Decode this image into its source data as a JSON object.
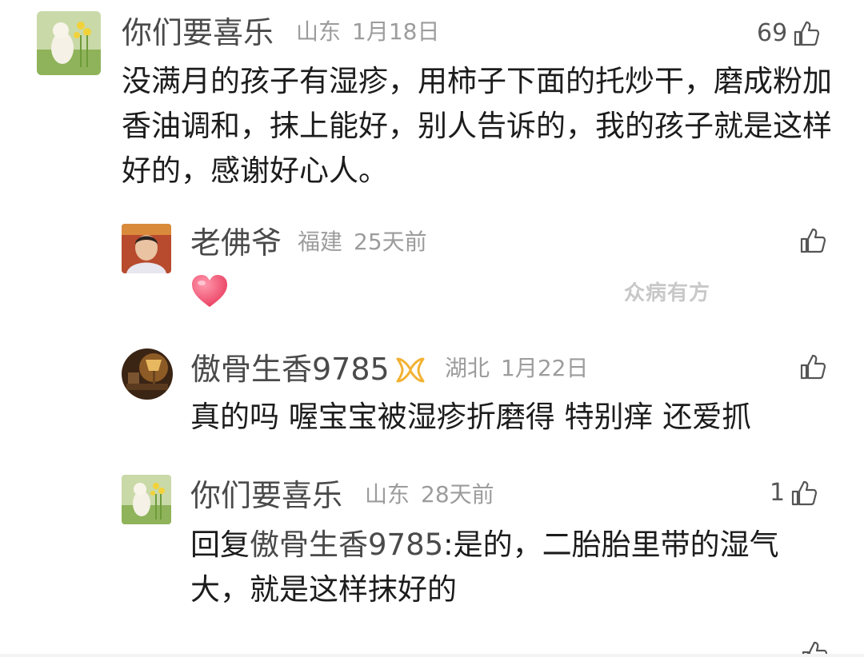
{
  "comments": [
    {
      "author": "你们要喜乐",
      "location": "山东",
      "date": "1月18日",
      "likes": "69",
      "text": "没满月的孩子有湿疹，用柿子下面的托炒干，磨成粉加香油调和，抹上能好，别人告诉的，我的孩子就是这样好的，感谢好心人。"
    },
    {
      "author": "老佛爷",
      "location": "福建",
      "date": "25天前",
      "likes": "",
      "content_icon": "heart-emoji"
    },
    {
      "author": "傲骨生香9785",
      "badge_icon": "ribbon-icon",
      "location": "湖北",
      "date": "1月22日",
      "likes": "",
      "text": "真的吗 喔宝宝被湿疹折磨得 特别痒 还爱抓"
    },
    {
      "author": "你们要喜乐",
      "location": "山东",
      "date": "28天前",
      "likes": "1",
      "reply_prefix": "回复",
      "reply_to": "傲骨生香9785",
      "reply_text": ":是的，二胎胎里带的湿气大，就是这样抹好的"
    }
  ],
  "watermark": "众病有方",
  "colors": {
    "author": "#4a4a4a",
    "meta": "#9c9c9c",
    "text": "#1c1c1c",
    "heart": "#f0506e",
    "badge": "#f2b233"
  }
}
